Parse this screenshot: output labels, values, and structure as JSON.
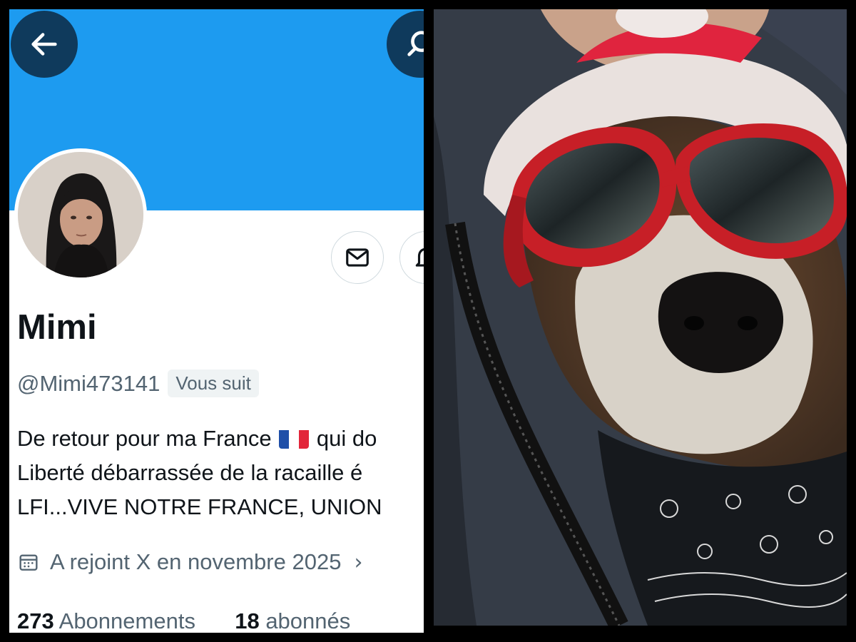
{
  "profile": {
    "display_name": "Mimi",
    "handle": "@Mimi473141",
    "follows_you_badge": "Vous suit",
    "bio_lines": [
      "De retour pour ma France",
      "qui do",
      "Liberté débarrassée de la racaille é",
      "LFI...VIVE NOTRE FRANCE, UNION"
    ],
    "joined": "A rejoint X en novembre 2025",
    "following_count": "273",
    "following_label": "Abonnements",
    "followers_count": "18",
    "followers_label": "abonnés"
  },
  "icons": {
    "back": "arrow-left-icon",
    "search": "search-icon",
    "message": "envelope-icon",
    "notifications": "bell-icon",
    "joined": "calendar-icon",
    "flag": "france-flag-icon"
  },
  "colors": {
    "banner": "#1d9bf0",
    "header_button": "#0f3a5c",
    "primary_text": "#0f1419",
    "secondary_text": "#536471",
    "badge_bg": "#eff3f4"
  },
  "right_photo": {
    "subject": "dog-in-red-goggles-and-santa-hat"
  }
}
